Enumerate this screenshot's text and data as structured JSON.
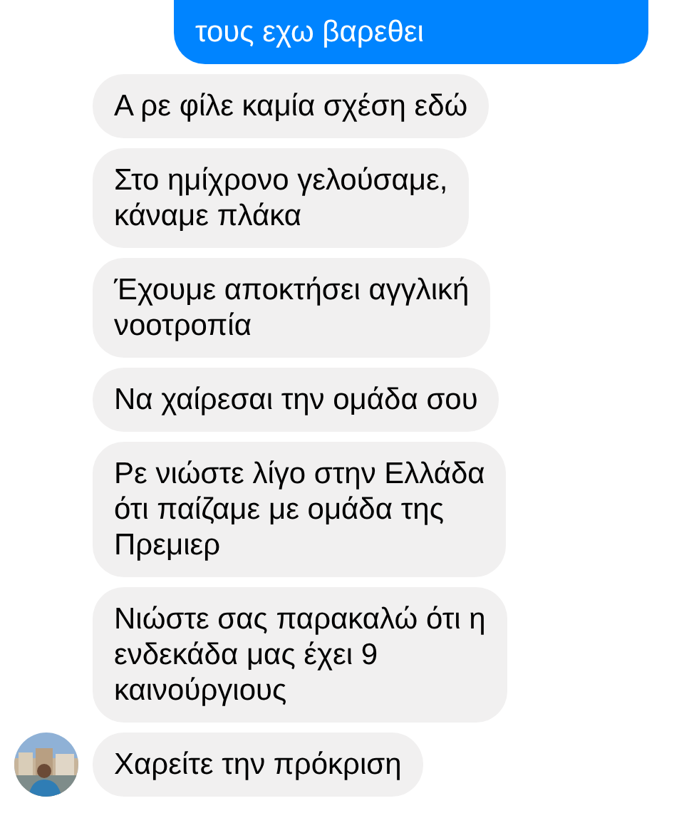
{
  "messages": [
    {
      "kind": "sent",
      "text": "τους εχω βαρεθει"
    },
    {
      "kind": "received",
      "text": "Α ρε φίλε καμία σχέση εδώ",
      "avatar": false
    },
    {
      "kind": "received",
      "text": "Στο ημίχρονο γελούσαμε,\nκάναμε πλάκα",
      "avatar": false
    },
    {
      "kind": "received",
      "text": "Έχουμε αποκτήσει αγγλική\nνοοτροπία",
      "avatar": false
    },
    {
      "kind": "received",
      "text": "Να χαίρεσαι την ομάδα σου",
      "avatar": false
    },
    {
      "kind": "received",
      "text": "Ρε νιώστε λίγο στην Ελλάδα\nότι παίζαμε με ομάδα της\nΠρεμιερ",
      "avatar": false
    },
    {
      "kind": "received",
      "text": "Νιώστε σας παρακαλώ ότι η\nενδεκάδα μας έχει 9\nκαινούργιους",
      "avatar": false
    },
    {
      "kind": "received",
      "text": "Χαρείτε την πρόκριση",
      "avatar": true
    }
  ]
}
